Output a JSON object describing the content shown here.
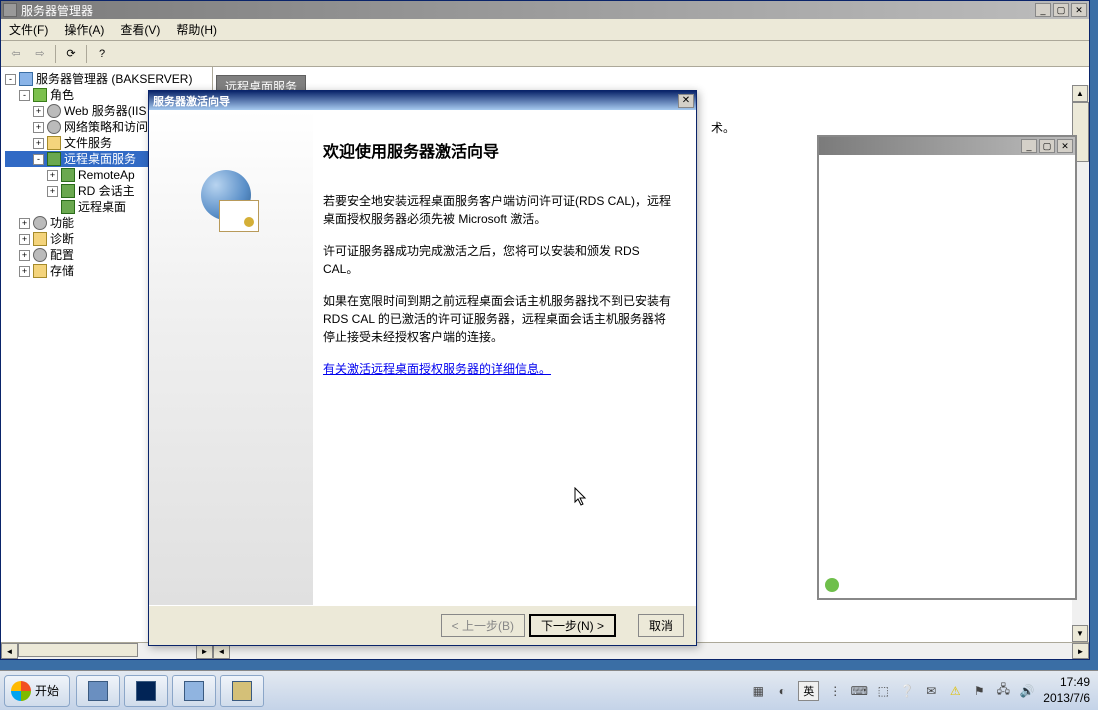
{
  "main_window": {
    "title": "服务器管理器",
    "menus": {
      "file": "文件(F)",
      "action": "操作(A)",
      "view": "查看(V)",
      "help": "帮助(H)"
    }
  },
  "right_pane": {
    "tab_label": "远程桌面服务",
    "floating_text": "术。"
  },
  "tree": {
    "root": "服务器管理器 (BAKSERVER)",
    "roles": "角色",
    "items": {
      "iis": "Web 服务器(IIS",
      "nps": "网络策略和访问",
      "file_services": "文件服务",
      "rds": "远程桌面服务",
      "remoteapp": "RemoteAp",
      "rd_session": "RD 会话主",
      "rd_remote": "远程桌面"
    },
    "features": "功能",
    "diagnostics": "诊断",
    "config": "配置",
    "storage": "存储"
  },
  "wizard": {
    "title": "服务器激活向导",
    "heading": "欢迎使用服务器激活向导",
    "p1": "若要安全地安装远程桌面服务客户端访问许可证(RDS CAL)，远程桌面授权服务器必须先被 Microsoft 激活。",
    "p2": "许可证服务器成功完成激活之后，您将可以安装和颁发 RDS CAL。",
    "p3": "如果在宽限时间到期之前远程桌面会话主机服务器找不到已安装有 RDS CAL 的已激活的许可证服务器，远程桌面会话主机服务器将停止接受未经授权客户端的连接。",
    "link": "有关激活远程桌面授权服务器的详细信息。",
    "buttons": {
      "back": "< 上一步(B)",
      "next": "下一步(N) >",
      "cancel": "取消"
    }
  },
  "taskbar": {
    "start": "开始",
    "ime": "英",
    "clock_time": "17:49",
    "clock_date": "2013/7/6"
  }
}
